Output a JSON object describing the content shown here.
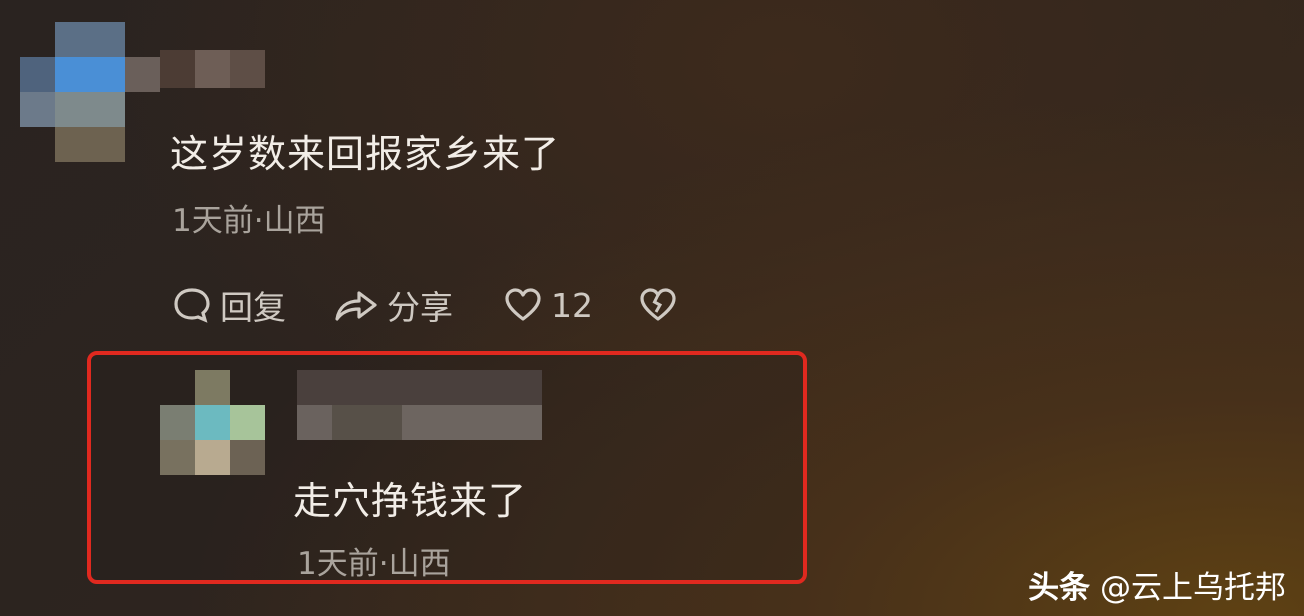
{
  "comment": {
    "text": "这岁数来回报家乡来了",
    "meta": "1天前·山西",
    "actions": {
      "reply_label": "回复",
      "share_label": "分享",
      "like_count": "12"
    }
  },
  "reply": {
    "text": "走穴挣钱来了",
    "meta": "1天前·山西",
    "highlight_color": "#e0291f"
  },
  "watermark": {
    "platform": "头条",
    "author": "@云上乌托邦"
  }
}
